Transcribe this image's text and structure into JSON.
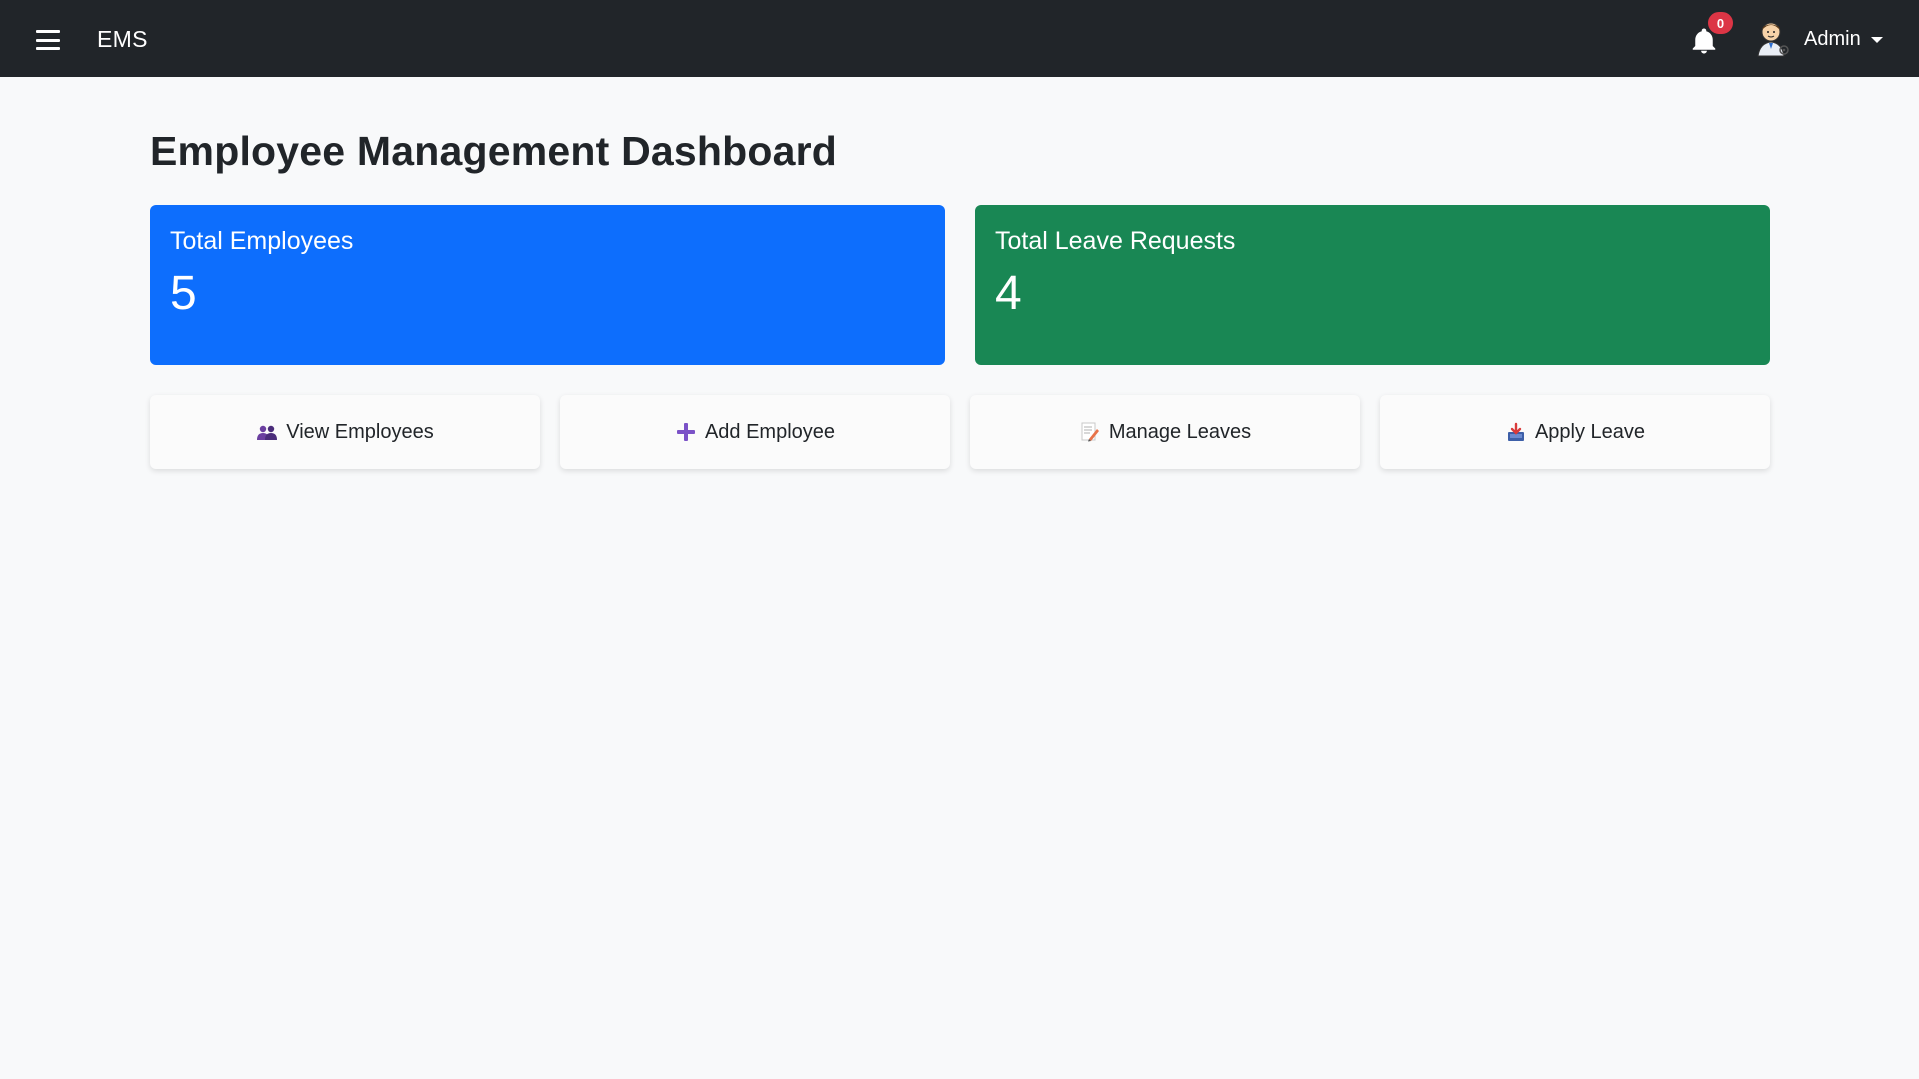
{
  "navbar": {
    "brand": "EMS",
    "notification_count": "0",
    "user_name": "Admin",
    "icons": {
      "menu": "hamburger-icon",
      "bell": "bell-icon",
      "avatar": "avatar",
      "dropdown": "caret-down-icon"
    }
  },
  "main": {
    "title": "Employee Management Dashboard",
    "stats": [
      {
        "label": "Total Employees",
        "value": "5",
        "color": "#0d6efd"
      },
      {
        "label": "Total Leave Requests",
        "value": "4",
        "color": "#198754"
      }
    ],
    "actions": [
      {
        "label": "View Employees",
        "icon": "people-icon"
      },
      {
        "label": "Add Employee",
        "icon": "plus-icon"
      },
      {
        "label": "Manage Leaves",
        "icon": "memo-icon"
      },
      {
        "label": "Apply Leave",
        "icon": "inbox-icon"
      }
    ]
  }
}
